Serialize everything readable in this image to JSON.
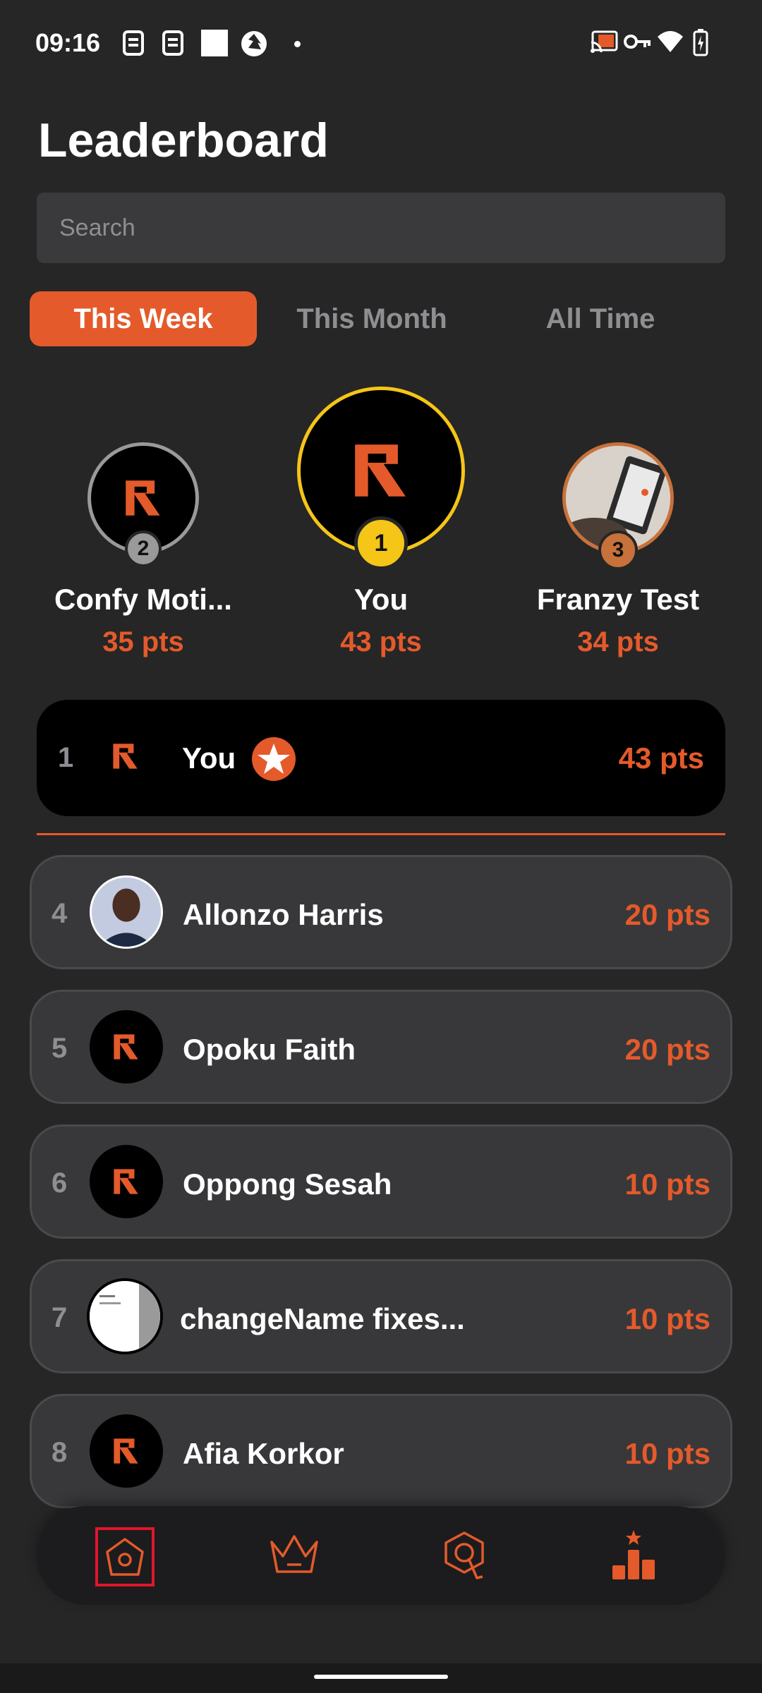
{
  "status_bar": {
    "time": "09:16",
    "icons_left": [
      "sim-icon",
      "sim-icon",
      "square-icon",
      "camera-shutter-icon",
      "dot-icon"
    ],
    "icons_right": [
      "cast-icon",
      "key-icon",
      "wifi-icon",
      "battery-charging-icon"
    ]
  },
  "page": {
    "title": "Leaderboard"
  },
  "search": {
    "placeholder": "Search"
  },
  "tabs": [
    {
      "label": "This Week",
      "active": true
    },
    {
      "label": "This Month",
      "active": false
    },
    {
      "label": "All Time",
      "active": false
    }
  ],
  "podium": [
    {
      "rank": "2",
      "name": "Confy Moti...",
      "points": "35 pts",
      "ring_color": "#9a9a9a",
      "avatar": "brand-logo-icon"
    },
    {
      "rank": "1",
      "name": "You",
      "points": "43 pts",
      "ring_color": "#f5c518",
      "avatar": "brand-logo-icon"
    },
    {
      "rank": "3",
      "name": "Franzy Test",
      "points": "34 pts",
      "ring_color": "#c7713b",
      "avatar": "photo-avatar"
    }
  ],
  "my_rank": {
    "rank": "1",
    "name": "You",
    "points": "43 pts",
    "badge": "star-badge-icon"
  },
  "list": [
    {
      "rank": "4",
      "name": "Allonzo Harris",
      "points": "20 pts",
      "avatar": "photo-avatar"
    },
    {
      "rank": "5",
      "name": "Opoku Faith",
      "points": "20 pts",
      "avatar": "brand-logo-icon"
    },
    {
      "rank": "6",
      "name": "Oppong Sesah",
      "points": "10 pts",
      "avatar": "brand-logo-icon"
    },
    {
      "rank": "7",
      "name": "changeName fixes...",
      "points": "10 pts",
      "avatar": "screenshot-avatar"
    },
    {
      "rank": "8",
      "name": "Afia Korkor",
      "points": "10 pts",
      "avatar": "brand-logo-icon"
    }
  ],
  "bottom_nav": [
    "home-icon",
    "crown-icon",
    "quiz-icon",
    "leaderboard-icon"
  ],
  "colors": {
    "accent": "#e45a2b",
    "background": "#262626",
    "card": "#38383a",
    "gold": "#f5c518",
    "silver": "#9a9a9a",
    "bronze": "#c7713b"
  }
}
